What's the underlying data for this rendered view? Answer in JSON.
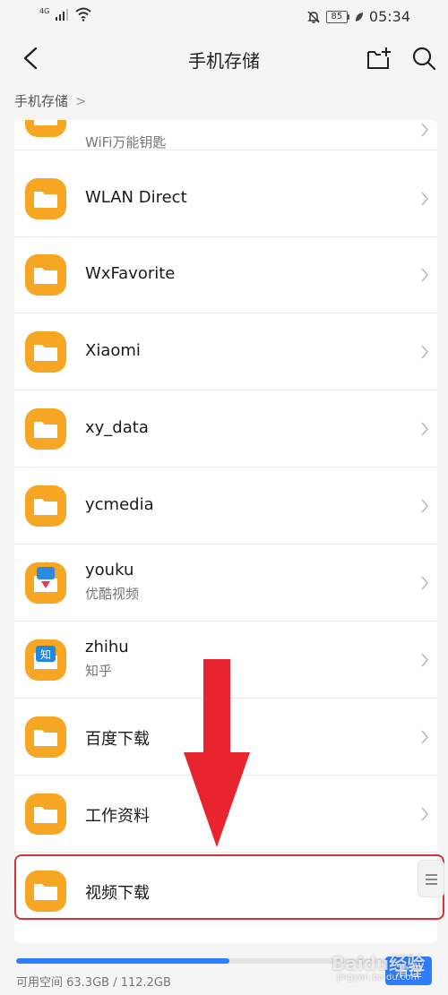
{
  "status_bar": {
    "network": "4G",
    "battery": "85",
    "time": "05:34"
  },
  "header": {
    "title": "手机存储"
  },
  "breadcrumb": {
    "label": "手机存储",
    "separator": ">"
  },
  "items": [
    {
      "name": "WiFi万能钥匙",
      "sub": "WiFi万能钥匙",
      "icon": "folder-icon"
    },
    {
      "name": "WLAN Direct",
      "sub": "",
      "icon": "folder-icon"
    },
    {
      "name": "WxFavorite",
      "sub": "",
      "icon": "folder-icon"
    },
    {
      "name": "Xiaomi",
      "sub": "",
      "icon": "folder-icon"
    },
    {
      "name": "xy_data",
      "sub": "",
      "icon": "folder-icon"
    },
    {
      "name": "ycmedia",
      "sub": "",
      "icon": "folder-icon"
    },
    {
      "name": "youku",
      "sub": "优酷视频",
      "icon": "youku-folder-icon"
    },
    {
      "name": "zhihu",
      "sub": "知乎",
      "icon": "zhihu-folder-icon"
    },
    {
      "name": "百度下载",
      "sub": "",
      "icon": "folder-icon"
    },
    {
      "name": "工作资料",
      "sub": "",
      "icon": "folder-icon"
    },
    {
      "name": "视频下载",
      "sub": "",
      "icon": "folder-icon"
    }
  ],
  "storage": {
    "used_fraction": 0.564,
    "text": "可用空间 63.3GB / 112.2GB",
    "clean_label": "清理"
  },
  "watermark": {
    "brand": "Baidu经验",
    "url": "jingyan.baidu.com"
  },
  "colors": {
    "folder": "#f6a623",
    "accent": "#2d7dff",
    "highlight": "#d9303a",
    "arrow": "#e8252f"
  }
}
